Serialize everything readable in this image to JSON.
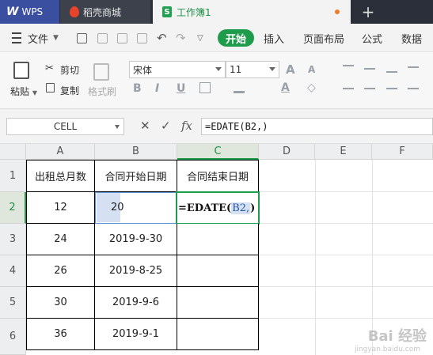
{
  "tabs": {
    "wps": "WPS",
    "store": "稻壳商城",
    "workbook": "工作簿1"
  },
  "menu": {
    "file": "文件",
    "items": [
      "开始",
      "插入",
      "页面布局",
      "公式",
      "数据"
    ]
  },
  "ribbon": {
    "paste": "粘贴",
    "cut": "剪切",
    "copy": "复制",
    "format_painter": "格式刷",
    "font_name": "宋体",
    "font_size": "11",
    "bold": "B",
    "italic": "I",
    "underline": "U"
  },
  "formula_bar": {
    "name_box": "CELL",
    "fx": "fx",
    "formula": "=EDATE(B2,)"
  },
  "grid": {
    "columns": [
      "A",
      "B",
      "C",
      "D",
      "E",
      "F"
    ],
    "rows": [
      "1",
      "2",
      "3",
      "4",
      "5",
      "6"
    ],
    "headers": [
      "出租总月数",
      "合同开始日期",
      "合同结束日期"
    ],
    "data": [
      [
        "12",
        "20",
        ""
      ],
      [
        "24",
        "2019-9-30",
        ""
      ],
      [
        "26",
        "2019-8-25",
        ""
      ],
      [
        "30",
        "2019-9-6",
        ""
      ],
      [
        "36",
        "2019-9-1",
        ""
      ]
    ],
    "editing_cell": {
      "prefix": "=EDATE(",
      "ref": "B2,",
      "suffix": ")"
    }
  },
  "watermark": "Bai 经验",
  "watermark_sub": "jingyan.baidu.com",
  "colors": {
    "accent": "#1f9c4b",
    "tab_wps": "#3b4fa0",
    "selection": "#d5e1f2"
  }
}
